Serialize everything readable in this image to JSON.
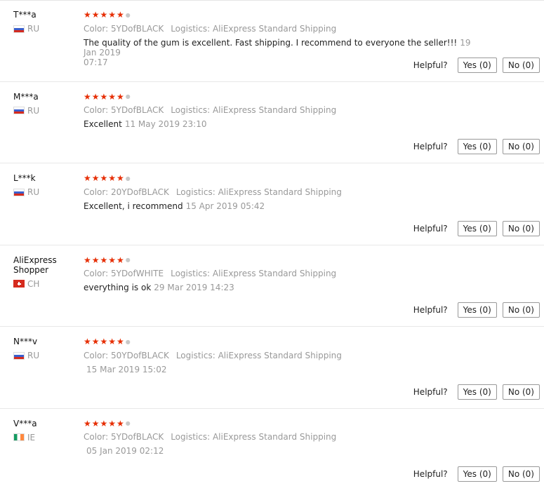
{
  "helpful_label": "Helpful?",
  "reviews": [
    {
      "user": "T***a",
      "country": "RU",
      "flag": "ru",
      "stars": "★★★★★",
      "color": "Color: 5YDofBLACK",
      "logistics": "Logistics: AliExpress Standard Shipping",
      "text": "The quality of the gum is excellent. Fast shipping. I recommend to everyone the seller!!!",
      "date_part1": "19 Jan 2019",
      "date_part2": "07:17",
      "yes": "Yes (0)",
      "no": "No (0)"
    },
    {
      "user": "M***a",
      "country": "RU",
      "flag": "ru",
      "stars": "★★★★★",
      "color": "Color: 5YDofBLACK",
      "logistics": "Logistics: AliExpress Standard Shipping",
      "text": "Excellent",
      "date": "11 May 2019 23:10",
      "yes": "Yes (0)",
      "no": "No (0)"
    },
    {
      "user": "L***k",
      "country": "RU",
      "flag": "ru",
      "stars": "★★★★★",
      "color": "Color: 20YDofBLACK",
      "logistics": "Logistics: AliExpress Standard Shipping",
      "text": "Excellent, i recommend",
      "date": "15 Apr 2019 05:42",
      "yes": "Yes (0)",
      "no": "No (0)"
    },
    {
      "user": "AliExpress Shopper",
      "country": "CH",
      "flag": "ch",
      "stars": "★★★★★",
      "color": "Color: 5YDofWHITE",
      "logistics": "Logistics: AliExpress Standard Shipping",
      "text": "everything is ok",
      "date": "29 Mar 2019 14:23",
      "yes": "Yes (0)",
      "no": "No (0)"
    },
    {
      "user": "N***v",
      "country": "RU",
      "flag": "ru",
      "stars": "★★★★★",
      "color": "Color: 50YDofBLACK",
      "logistics": "Logistics: AliExpress Standard Shipping",
      "text": "",
      "date": "15 Mar 2019 15:02",
      "yes": "Yes (0)",
      "no": "No (0)"
    },
    {
      "user": "V***a",
      "country": "IE",
      "flag": "ie",
      "stars": "★★★★★",
      "color": "Color: 5YDofBLACK",
      "logistics": "Logistics: AliExpress Standard Shipping",
      "text": "",
      "date": "05 Jan 2019 02:12",
      "yes": "Yes (0)",
      "no": "No (0)"
    }
  ],
  "star_color": "#e62e04"
}
